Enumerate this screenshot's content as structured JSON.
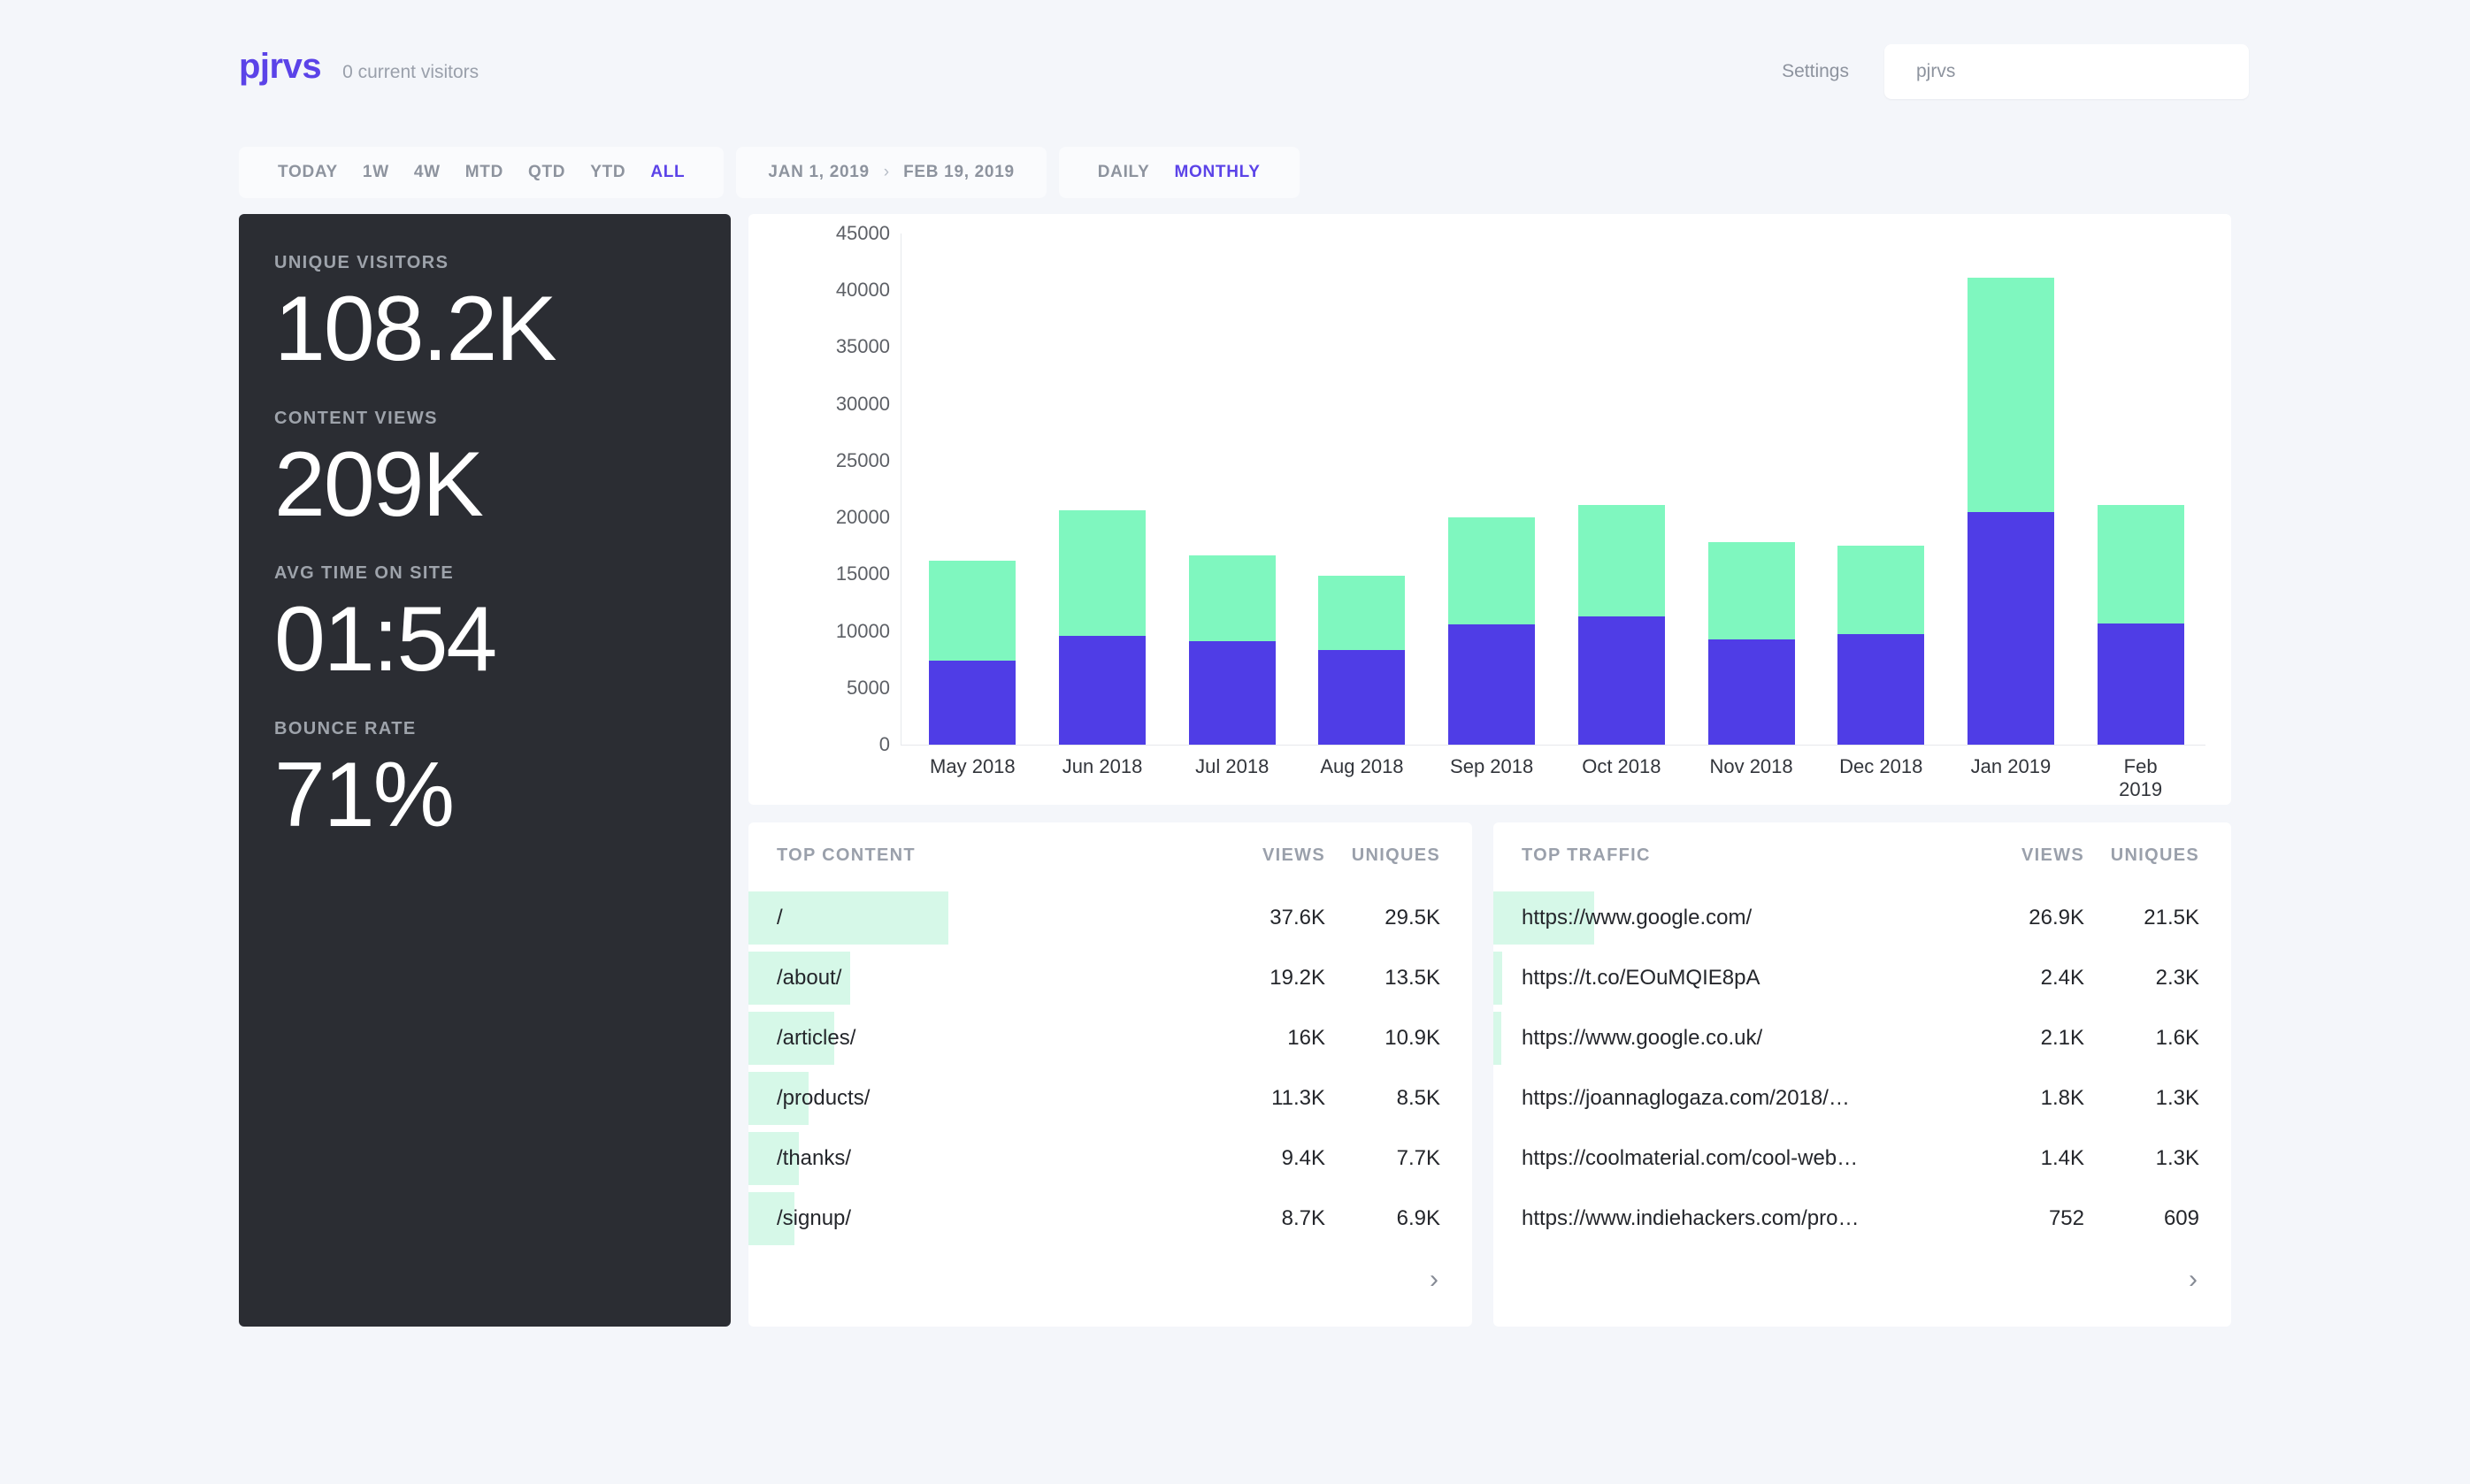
{
  "header": {
    "logo": "pjrvs",
    "visitors_text": "0 current visitors",
    "settings_label": "Settings",
    "site_select_value": "pjrvs"
  },
  "toolbar": {
    "ranges": [
      {
        "label": "TODAY",
        "active": false
      },
      {
        "label": "1W",
        "active": false
      },
      {
        "label": "4W",
        "active": false
      },
      {
        "label": "MTD",
        "active": false
      },
      {
        "label": "QTD",
        "active": false
      },
      {
        "label": "YTD",
        "active": false
      },
      {
        "label": "ALL",
        "active": true
      }
    ],
    "date_from": "JAN 1, 2019",
    "date_sep": "›",
    "date_to": "FEB 19, 2019",
    "granularity": [
      {
        "label": "DAILY",
        "active": false
      },
      {
        "label": "MONTHLY",
        "active": true
      }
    ]
  },
  "sidebar": {
    "stats": [
      {
        "label": "UNIQUE VISITORS",
        "value": "108.2K"
      },
      {
        "label": "CONTENT VIEWS",
        "value": "209K"
      },
      {
        "label": "AVG TIME ON SITE",
        "value": "01:54"
      },
      {
        "label": "BOUNCE RATE",
        "value": "71%"
      }
    ]
  },
  "chart_data": {
    "type": "bar",
    "stacked": true,
    "title": "",
    "xlabel": "",
    "ylabel": "",
    "ylim": [
      0,
      45000
    ],
    "yticks": [
      0,
      5000,
      10000,
      15000,
      20000,
      25000,
      30000,
      35000,
      40000,
      45000
    ],
    "grid": false,
    "legend_position": "none",
    "categories": [
      "May 2018",
      "Jun 2018",
      "Jul 2018",
      "Aug 2018",
      "Sep 2018",
      "Oct 2018",
      "Nov 2018",
      "Dec 2018",
      "Jan 2019",
      "Feb 2019"
    ],
    "series": [
      {
        "name": "Unique visitors",
        "color": "#4f3de6",
        "values": [
          7400,
          9600,
          9100,
          8300,
          10600,
          11300,
          9300,
          9700,
          20500,
          10700
        ]
      },
      {
        "name": "Content views",
        "color": "#7ff7bf",
        "values": [
          8800,
          11000,
          7600,
          6600,
          9400,
          9800,
          8500,
          7800,
          20600,
          10400
        ]
      }
    ],
    "totals": [
      16200,
      20600,
      16700,
      14900,
      20000,
      21100,
      17800,
      17500,
      41100,
      21100
    ]
  },
  "top_content": {
    "title": "TOP CONTENT",
    "col_views": "VIEWS",
    "col_uniques": "UNIQUES",
    "rows": [
      {
        "label": "/",
        "views": "37.6K",
        "uniques": "29.5K",
        "bar_pct": 100
      },
      {
        "label": "/about/",
        "views": "19.2K",
        "uniques": "13.5K",
        "bar_pct": 51
      },
      {
        "label": "/articles/",
        "views": "16K",
        "uniques": "10.9K",
        "bar_pct": 43
      },
      {
        "label": "/products/",
        "views": "11.3K",
        "uniques": "8.5K",
        "bar_pct": 30
      },
      {
        "label": "/thanks/",
        "views": "9.4K",
        "uniques": "7.7K",
        "bar_pct": 25
      },
      {
        "label": "/signup/",
        "views": "8.7K",
        "uniques": "6.9K",
        "bar_pct": 23
      }
    ],
    "next_icon": "›"
  },
  "top_traffic": {
    "title": "TOP TRAFFIC",
    "col_views": "VIEWS",
    "col_uniques": "UNIQUES",
    "rows": [
      {
        "label": "https://www.google.com/",
        "views": "26.9K",
        "uniques": "21.5K",
        "bar_pct": 100
      },
      {
        "label": "https://t.co/EOuMQIE8pA",
        "views": "2.4K",
        "uniques": "2.3K",
        "bar_pct": 9
      },
      {
        "label": "https://www.google.co.uk/",
        "views": "2.1K",
        "uniques": "1.6K",
        "bar_pct": 8
      },
      {
        "label": "https://joannaglogaza.com/2018/…",
        "views": "1.8K",
        "uniques": "1.3K",
        "bar_pct": 0
      },
      {
        "label": "https://coolmaterial.com/cool-web…",
        "views": "1.4K",
        "uniques": "1.3K",
        "bar_pct": 0
      },
      {
        "label": "https://www.indiehackers.com/pro…",
        "views": "752",
        "uniques": "609",
        "bar_pct": 0
      }
    ],
    "next_icon": "›"
  },
  "colors": {
    "accent": "#5b43e8",
    "bar_unique": "#4f3de6",
    "bar_views": "#7ff7bf",
    "row_bar": "#d6f8e8",
    "sidebar_bg": "#2b2d33",
    "page_bg": "#f4f6fa"
  }
}
